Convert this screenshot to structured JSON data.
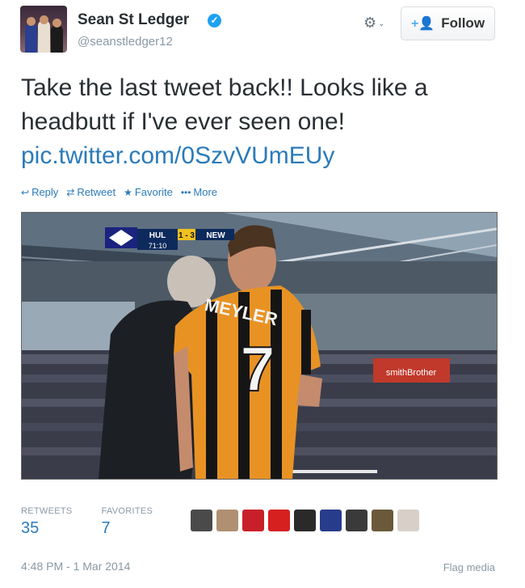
{
  "user": {
    "name": "Sean St Ledger",
    "handle": "@seanstledger12",
    "verified_mark": "✓"
  },
  "header": {
    "gear_icon": "⚙",
    "chevron": "⌄",
    "follow_icon": "+👤",
    "follow_label": "Follow"
  },
  "tweet": {
    "text": "Take the last tweet back!! Looks like a headbutt if I've ever seen one!",
    "link": "pic.twitter.com/0SzvVUmEUy"
  },
  "actions": [
    {
      "icon": "↩",
      "label": "Reply"
    },
    {
      "icon": "⇄",
      "label": "Retweet"
    },
    {
      "icon": "★",
      "label": "Favorite"
    },
    {
      "icon": "•••",
      "label": "More"
    }
  ],
  "media": {
    "scoreboard": {
      "home": "HUL",
      "score": "1 - 3",
      "away": "NEW",
      "time": "71:10"
    },
    "shirt_name": "MEYLER",
    "shirt_number": "7",
    "banner": "smithBrother"
  },
  "stats": {
    "retweets_label": "RETWEETS",
    "retweets_value": "35",
    "favorites_label": "FAVORITES",
    "favorites_value": "7"
  },
  "favoriters": [
    "#4a4a4a",
    "#b09070",
    "#c8202a",
    "#d62020",
    "#2a2a2a",
    "#283c8c",
    "#3a3a3a",
    "#6a5a3a",
    "#d8d0c8"
  ],
  "footer": {
    "timestamp": "4:48 PM - 1 Mar 2014",
    "flag_label": "Flag media"
  }
}
